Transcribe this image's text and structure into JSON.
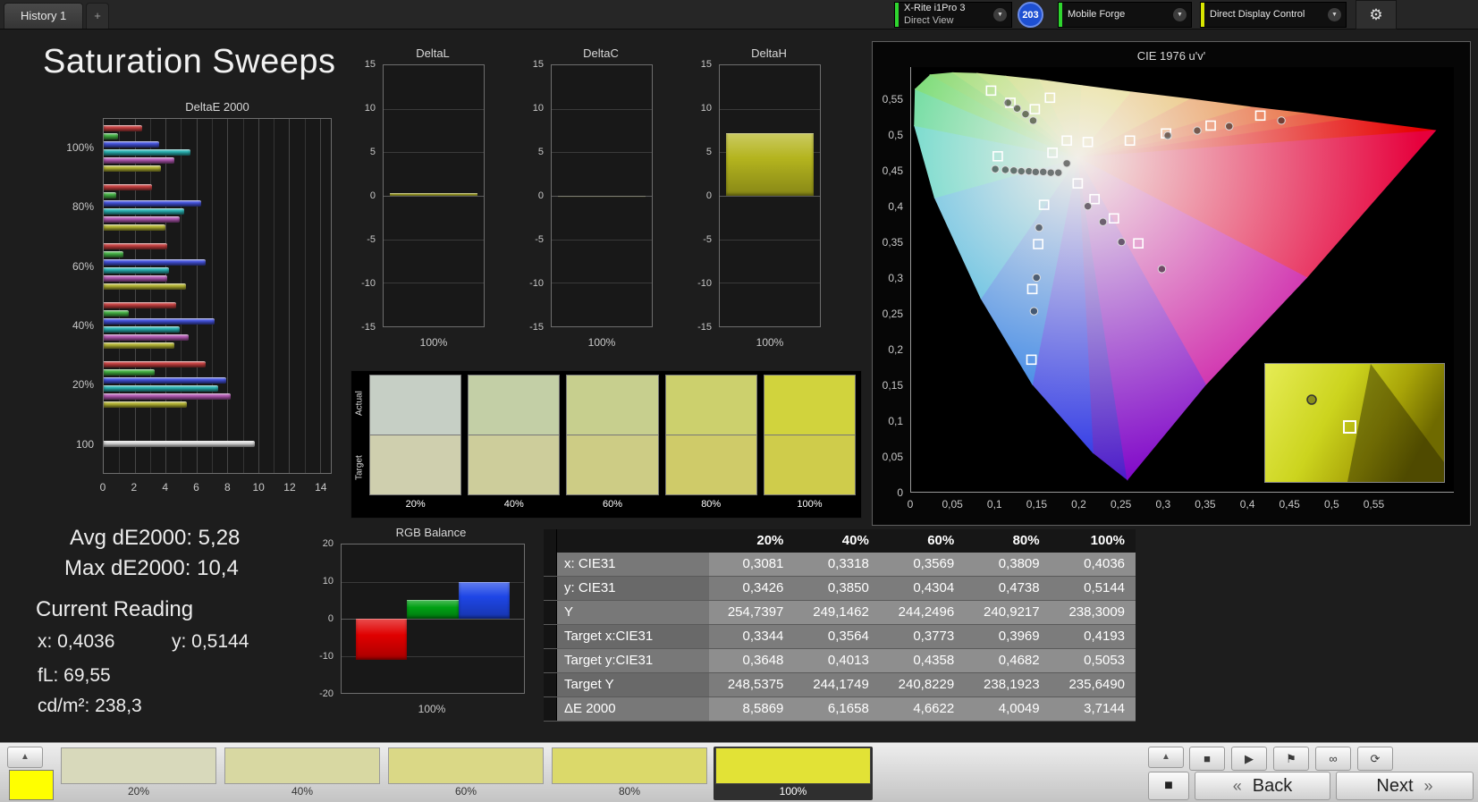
{
  "topbar": {
    "tab": "History 1",
    "new_tab": "+",
    "dropdown_glyph": "▼",
    "gear_glyph": "⚙",
    "meter": {
      "line1": "X-Rite i1Pro 3",
      "line2": "Direct View",
      "accent": "#2fd52f"
    },
    "badge": "203",
    "badge_color": "#1e50d2",
    "source": "Mobile Forge",
    "source_accent": "#2fd52f",
    "display": "Direct Display Control",
    "display_accent": "#d8e600"
  },
  "page_title": "Saturation Sweeps",
  "readings": {
    "avg": "Avg dE2000: 5,28",
    "max": "Max dE2000: 10,4",
    "current": "Current Reading",
    "x": "x: 0,4036",
    "y": "y: 0,5144",
    "fl": "fL: 69,55",
    "cd": "cd/m²: 238,3"
  },
  "comparator": {
    "rows": [
      "Actual",
      "Target"
    ],
    "columns": [
      {
        "label": "20%",
        "actual": "#c6cfc5",
        "target": "#cfcfae"
      },
      {
        "label": "40%",
        "actual": "#c3cfa6",
        "target": "#cdcd9b"
      },
      {
        "label": "60%",
        "actual": "#c7cf8e",
        "target": "#cdcc85"
      },
      {
        "label": "80%",
        "actual": "#ccd06d",
        "target": "#cfcb69"
      },
      {
        "label": "100%",
        "actual": "#d1d33d",
        "target": "#cfcc4b"
      }
    ]
  },
  "table": {
    "headers": [
      "",
      "20%",
      "40%",
      "60%",
      "80%",
      "100%"
    ],
    "rows": [
      {
        "label": "x: CIE31",
        "values": [
          "0,3081",
          "0,3318",
          "0,3569",
          "0,3809",
          "0,4036"
        ]
      },
      {
        "label": "y: CIE31",
        "values": [
          "0,3426",
          "0,3850",
          "0,4304",
          "0,4738",
          "0,5144"
        ]
      },
      {
        "label": "Y",
        "values": [
          "254,7397",
          "249,1462",
          "244,2496",
          "240,9217",
          "238,3009"
        ]
      },
      {
        "label": "Target x:CIE31",
        "values": [
          "0,3344",
          "0,3564",
          "0,3773",
          "0,3969",
          "0,4193"
        ]
      },
      {
        "label": "Target y:CIE31",
        "values": [
          "0,3648",
          "0,4013",
          "0,4358",
          "0,4682",
          "0,5053"
        ]
      },
      {
        "label": "Target Y",
        "values": [
          "248,5375",
          "244,1749",
          "240,8229",
          "238,1923",
          "235,6490"
        ]
      },
      {
        "label": "ΔE 2000",
        "values": [
          "8,5869",
          "6,1658",
          "4,6622",
          "4,0049",
          "3,7144"
        ]
      }
    ]
  },
  "bottombar": {
    "collapse_glyph": "▲",
    "current_color": "#ffff00",
    "patches": [
      {
        "label": "20%",
        "color": "#d8d9bb"
      },
      {
        "label": "40%",
        "color": "#d8d8a2"
      },
      {
        "label": "60%",
        "color": "#dad886"
      },
      {
        "label": "80%",
        "color": "#dbd96a"
      },
      {
        "label": "100%",
        "color": "#e2e236",
        "selected": true
      }
    ],
    "transport": [
      {
        "name": "stop",
        "glyph": "■"
      },
      {
        "name": "play",
        "glyph": "▶"
      },
      {
        "name": "flag",
        "glyph": "⚑"
      },
      {
        "name": "continuous",
        "glyph": "∞"
      },
      {
        "name": "refresh",
        "glyph": "⟳"
      }
    ],
    "big_stop_glyph": "■",
    "back_chevron": "«",
    "next_chevron": "»",
    "back": "Back",
    "next": "Next"
  },
  "chart_data": {
    "deltae2000": {
      "type": "bar",
      "orientation": "horizontal",
      "title": "DeltaE 2000",
      "xmax": 14.7,
      "xticks": [
        0,
        2,
        4,
        6,
        8,
        10,
        12,
        14
      ],
      "series_names": [
        "Red",
        "Green",
        "Blue",
        "Cyan",
        "Magenta",
        "Yellow"
      ],
      "series_colors": [
        "#c84040",
        "#46b446",
        "#4654e0",
        "#2ab4b4",
        "#b45ab4",
        "#b4b432"
      ],
      "groups": [
        {
          "label": "100%",
          "values": [
            2.5,
            0.9,
            3.6,
            5.6,
            4.6,
            3.7
          ]
        },
        {
          "label": "80%",
          "values": [
            3.1,
            0.8,
            6.3,
            5.2,
            4.9,
            4.0
          ]
        },
        {
          "label": "60%",
          "values": [
            4.1,
            1.3,
            6.6,
            4.2,
            4.1,
            5.3
          ]
        },
        {
          "label": "40%",
          "values": [
            4.7,
            1.6,
            7.2,
            4.9,
            5.5,
            4.6
          ]
        },
        {
          "label": "20%",
          "values": [
            6.6,
            3.3,
            7.9,
            7.4,
            8.2,
            5.4
          ]
        },
        {
          "label": "100",
          "values": [
            9.8
          ],
          "colors": [
            "#dcdcdc"
          ]
        }
      ]
    },
    "deltal": {
      "type": "bar",
      "title": "DeltaL",
      "ylim": [
        -15,
        15
      ],
      "ystep": 5,
      "category": "100%",
      "value": 0.3,
      "color": "#c8c832"
    },
    "deltac": {
      "type": "bar",
      "title": "DeltaC",
      "ylim": [
        -15,
        15
      ],
      "ystep": 5,
      "category": "100%",
      "value": -0.2,
      "color": "#3c3c28"
    },
    "deltah": {
      "type": "bar",
      "title": "DeltaH",
      "ylim": [
        -15,
        15
      ],
      "ystep": 5,
      "category": "100%",
      "value": 7.2,
      "color": "#b4b41e"
    },
    "rgb_balance": {
      "type": "bar",
      "title": "RGB Balance",
      "ylim": [
        -20,
        20
      ],
      "ystep": 10,
      "category": "100%",
      "series": [
        {
          "name": "Red",
          "value": -11,
          "color": "#e00000"
        },
        {
          "name": "Green",
          "value": 5,
          "color": "#00a014"
        },
        {
          "name": "Blue",
          "value": 10,
          "color": "#1e46e6"
        }
      ]
    },
    "cie": {
      "type": "scatter",
      "title": "CIE 1976 u'v'",
      "umax": 0.645,
      "vmax": 0.595,
      "white_point": [
        0.198,
        0.468
      ],
      "locus": [
        [
          0.257,
          0.017
        ],
        [
          0.216,
          0.055
        ],
        [
          0.144,
          0.151
        ],
        [
          0.083,
          0.271
        ],
        [
          0.028,
          0.412
        ],
        [
          0.004,
          0.513
        ],
        [
          0.005,
          0.564
        ],
        [
          0.023,
          0.584
        ],
        [
          0.05,
          0.587
        ],
        [
          0.079,
          0.586
        ],
        [
          0.113,
          0.582
        ],
        [
          0.153,
          0.577
        ],
        [
          0.203,
          0.569
        ],
        [
          0.262,
          0.56
        ],
        [
          0.332,
          0.55
        ],
        [
          0.403,
          0.539
        ],
        [
          0.469,
          0.53
        ],
        [
          0.52,
          0.522
        ],
        [
          0.623,
          0.506
        ]
      ],
      "purple_line": [
        [
          0.47,
          0.3
        ],
        [
          0.35,
          0.15
        ]
      ],
      "segment_colors": [
        "#4614c8",
        "#1e28e6",
        "#0064e6",
        "#00a0e0",
        "#00c8b4",
        "#00cd64",
        "#14cd14",
        "#28c800",
        "#50cd00",
        "#78d200",
        "#a0cd00",
        "#c3c800",
        "#dcc800",
        "#e69600",
        "#e66400",
        "#e63c00",
        "#e62000",
        "#e60000",
        "#e6003c",
        "#c800a0",
        "#7d00c8"
      ],
      "targets": [
        [
          0.095,
          0.562
        ],
        [
          0.165,
          0.552
        ],
        [
          0.118,
          0.545
        ],
        [
          0.147,
          0.536
        ],
        [
          0.168,
          0.475
        ],
        [
          0.185,
          0.492
        ],
        [
          0.21,
          0.49
        ],
        [
          0.26,
          0.492
        ],
        [
          0.303,
          0.502
        ],
        [
          0.356,
          0.513
        ],
        [
          0.415,
          0.527
        ],
        [
          0.198,
          0.432
        ],
        [
          0.218,
          0.41
        ],
        [
          0.241,
          0.383
        ],
        [
          0.27,
          0.348
        ],
        [
          0.158,
          0.402
        ],
        [
          0.151,
          0.347
        ],
        [
          0.144,
          0.284
        ],
        [
          0.143,
          0.185
        ],
        [
          0.103,
          0.47
        ]
      ],
      "measured": [
        [
          0.115,
          0.545
        ],
        [
          0.126,
          0.537
        ],
        [
          0.136,
          0.529
        ],
        [
          0.145,
          0.52
        ],
        [
          0.305,
          0.499
        ],
        [
          0.34,
          0.506
        ],
        [
          0.378,
          0.512
        ],
        [
          0.44,
          0.52
        ],
        [
          0.21,
          0.4
        ],
        [
          0.228,
          0.378
        ],
        [
          0.25,
          0.35
        ],
        [
          0.298,
          0.312
        ],
        [
          0.152,
          0.37
        ],
        [
          0.149,
          0.3
        ],
        [
          0.146,
          0.253
        ],
        [
          0.1,
          0.452
        ],
        [
          0.112,
          0.451
        ],
        [
          0.122,
          0.45
        ],
        [
          0.131,
          0.449
        ],
        [
          0.14,
          0.449
        ],
        [
          0.148,
          0.448
        ],
        [
          0.157,
          0.448
        ],
        [
          0.166,
          0.447
        ],
        [
          0.175,
          0.447
        ],
        [
          0.185,
          0.46
        ]
      ],
      "ticks": {
        "x": [
          "0",
          "0,05",
          "0,1",
          "0,15",
          "0,2",
          "0,25",
          "0,3",
          "0,35",
          "0,4",
          "0,45",
          "0,5",
          "0,55"
        ],
        "y": [
          "0",
          "0,05",
          "0,1",
          "0,15",
          "0,2",
          "0,25",
          "0,3",
          "0,35",
          "0,4",
          "0,45",
          "0,5",
          "0,55"
        ]
      }
    }
  }
}
